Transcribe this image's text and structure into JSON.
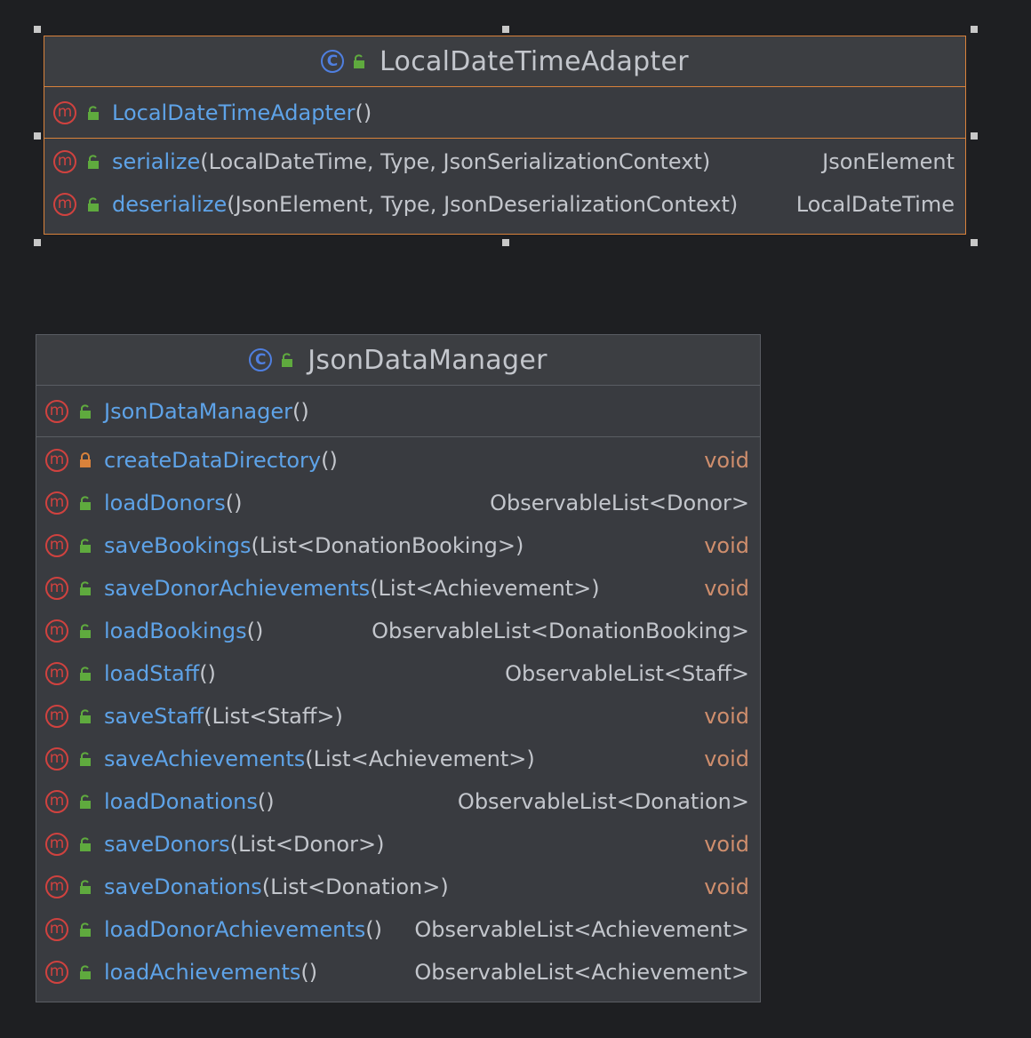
{
  "colors": {
    "background": "#1e1f22",
    "box": "#393b40",
    "selected_border": "#d9823b",
    "method_name": "#5ea3e8",
    "text": "#c3c6cc",
    "void": "#cf8e6d",
    "class_icon": "#4f7fe0",
    "method_icon": "#d0423f",
    "public_icon": "#5faa3e",
    "private_icon": "#d9823b"
  },
  "classes": [
    {
      "name": "LocalDateTimeAdapter",
      "icon": "class-icon",
      "visibility": "public",
      "selected": true,
      "constructors": [
        {
          "name": "LocalDateTimeAdapter",
          "params": "()",
          "type": "",
          "visibility": "public"
        }
      ],
      "methods": [
        {
          "name": "serialize",
          "params": "(LocalDateTime, Type, JsonSerializationContext)",
          "type": "JsonElement",
          "visibility": "public"
        },
        {
          "name": "deserialize",
          "params": "(JsonElement, Type, JsonDeserializationContext)",
          "type": "LocalDateTime",
          "visibility": "public"
        }
      ]
    },
    {
      "name": "JsonDataManager",
      "icon": "class-icon",
      "visibility": "public",
      "selected": false,
      "constructors": [
        {
          "name": "JsonDataManager",
          "params": "()",
          "type": "",
          "visibility": "public"
        }
      ],
      "methods": [
        {
          "name": "createDataDirectory",
          "params": "()",
          "type": "void",
          "visibility": "private"
        },
        {
          "name": "loadDonors",
          "params": "()",
          "type": "ObservableList<Donor>",
          "visibility": "public"
        },
        {
          "name": "saveBookings",
          "params": "(List<DonationBooking>)",
          "type": "void",
          "visibility": "public"
        },
        {
          "name": "saveDonorAchievements",
          "params": "(List<Achievement>)",
          "type": "void",
          "visibility": "public"
        },
        {
          "name": "loadBookings",
          "params": "()",
          "type": "ObservableList<DonationBooking>",
          "visibility": "public"
        },
        {
          "name": "loadStaff",
          "params": "()",
          "type": "ObservableList<Staff>",
          "visibility": "public"
        },
        {
          "name": "saveStaff",
          "params": "(List<Staff>)",
          "type": "void",
          "visibility": "public"
        },
        {
          "name": "saveAchievements",
          "params": "(List<Achievement>)",
          "type": "void",
          "visibility": "public"
        },
        {
          "name": "loadDonations",
          "params": "()",
          "type": "ObservableList<Donation>",
          "visibility": "public"
        },
        {
          "name": "saveDonors",
          "params": "(List<Donor>)",
          "type": "void",
          "visibility": "public"
        },
        {
          "name": "saveDonations",
          "params": "(List<Donation>)",
          "type": "void",
          "visibility": "public"
        },
        {
          "name": "loadDonorAchievements",
          "params": "()",
          "type": "ObservableList<Achievement>",
          "visibility": "public"
        },
        {
          "name": "loadAchievements",
          "params": "()",
          "type": "ObservableList<Achievement>",
          "visibility": "public"
        }
      ]
    }
  ]
}
